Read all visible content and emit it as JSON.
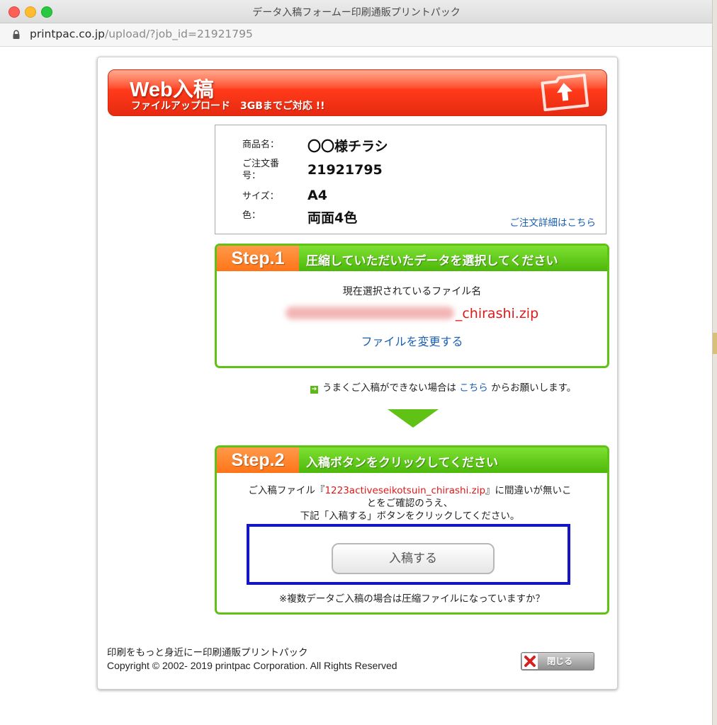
{
  "window": {
    "title": "データ入稿フォームー印刷通販プリントパック",
    "url_host": "printpac.co.jp",
    "url_path": "/upload/?job_id=21921795"
  },
  "banner": {
    "title": "Web入稿",
    "subtitle": "ファイルアップロード　3GBまでご対応 !!"
  },
  "order": {
    "product_label": "商品名：",
    "product_value": "〇〇様チラシ",
    "order_no_label_line1": "ご注文番",
    "order_no_label_line2": "号：",
    "order_no_value": "21921795",
    "size_label": "サイズ：",
    "size_value": "A4",
    "color_label": "色：",
    "color_value": "両面4色",
    "detail_link": "ご注文詳細はこちら"
  },
  "step1": {
    "num": "Step.1",
    "title": "圧縮していただいたデータを選択してください",
    "current_label": "現在選択されているファイル名",
    "file_visible": "_chirashi.zip",
    "change_link": "ファイルを変更する"
  },
  "help": {
    "before": "うまくご入稿ができない場合は",
    "link": "こちら",
    "after": "からお願いします。"
  },
  "step2": {
    "num": "Step.2",
    "title": "入稿ボタンをクリックしてください",
    "text_prefix": "ご入稿ファイル『",
    "file_name": "1223activeseikotsuin_chirashi.zip",
    "text_suffix_line1": "』に間違いが無いこ",
    "text_line2": "とをご確認のうえ、",
    "text_line3": "下記「入稿する」ボタンをクリックしてください。",
    "submit_label": "入稿する",
    "note": "※複数データご入稿の場合は圧縮ファイルになっていますか？"
  },
  "footer": {
    "tagline": "印刷をもっと身近にー印刷通販プリントパック",
    "copyright": "Copyright © 2002- 2019 printpac Corporation. All Rights Reserved",
    "close_label": "閉じる"
  },
  "colors": {
    "banner_red": "#ff3a1a",
    "step_green": "#5fc214",
    "step_orange": "#ff7418",
    "link_blue": "#1a5fb4",
    "file_red": "#e01818",
    "highlight_blue": "#1515c8"
  }
}
